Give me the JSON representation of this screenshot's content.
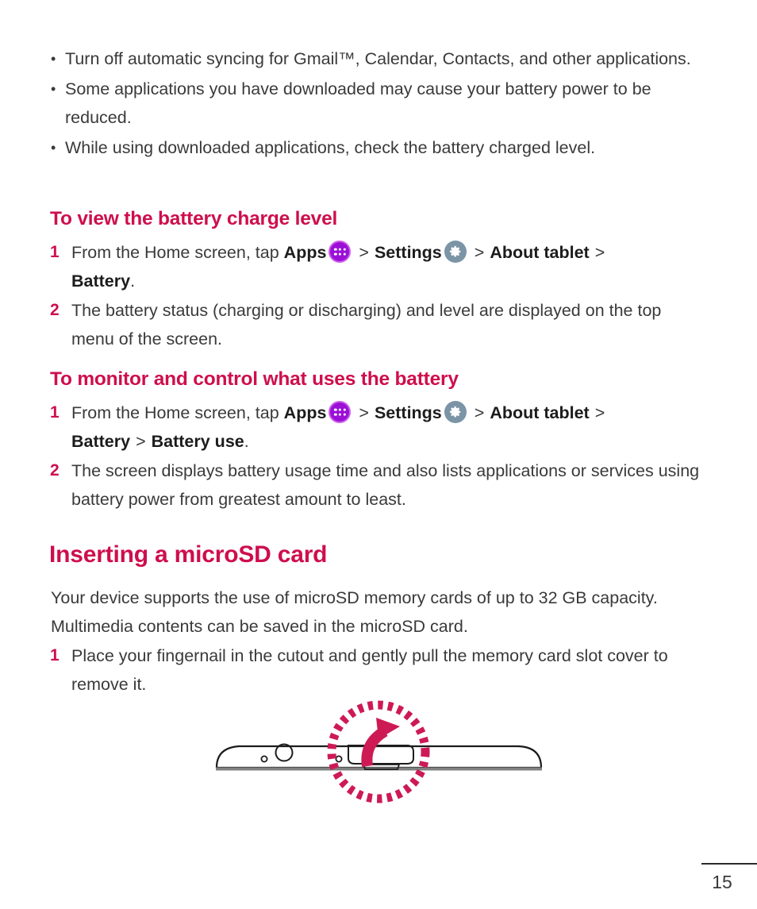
{
  "page": {
    "number": "15",
    "accent_color": "#ce0e4d",
    "body_color": "#3a3a3a"
  },
  "bullets": [
    {
      "marker": "•",
      "text": "Turn off automatic syncing for Gmail™, Calendar, Contacts, and other applications."
    },
    {
      "marker": "•",
      "text": "Some applications you have downloaded may cause your battery power to be reduced."
    },
    {
      "marker": "•",
      "text": "While using downloaded applications, check the battery charged level."
    }
  ],
  "section_one": {
    "heading": "To view the battery charge level",
    "steps": [
      {
        "number": "1",
        "prefix": "From the Home screen, tap ",
        "apps_label": "Apps",
        "apps_icon": "apps-grid-icon",
        "sep1": ">",
        "settings_label": "Settings",
        "settings_icon": "gear-icon",
        "sep2": ">",
        "about_label": "About tablet",
        "sep3": ">",
        "tail_bold": "Battery",
        "tail_plain": "."
      },
      {
        "number": "2",
        "text": "The battery status (charging or discharging) and level are displayed on the top menu of the screen."
      }
    ]
  },
  "section_two": {
    "heading": "To monitor and control what uses the battery",
    "steps": [
      {
        "number": "1",
        "prefix": "From the Home screen, tap ",
        "apps_label": "Apps",
        "apps_icon": "apps-grid-icon",
        "sep1": ">",
        "settings_label": "Settings",
        "settings_icon": "gear-icon",
        "sep2": ">",
        "about_label": "About tablet",
        "sep3": ">",
        "tail_bold": "Battery",
        "tail_sep": ">",
        "tail_bold2": "Battery use",
        "tail_plain": "."
      },
      {
        "number": "2",
        "text": "The screen displays battery usage time and also lists applications or services using battery power from greatest amount to least."
      }
    ]
  },
  "section_three": {
    "heading": "Inserting a microSD card",
    "paragraph": "Your device supports the use of microSD memory cards of up to 32 GB capacity. Multimedia contents can be saved in the microSD card.",
    "steps": [
      {
        "number": "1",
        "text": "Place your fingernail in the cutout and gently pull the memory card slot cover to remove it."
      }
    ],
    "illustration": {
      "name": "tablet-edge-microsd-slot-illustration",
      "highlight_circle": "dotted-highlight-circle",
      "arrow": "curved-up-arrow",
      "slot_cover": "memory-card-slot-cover",
      "camera": "camera-lens",
      "pinhole": "microphone-pinhole"
    }
  }
}
